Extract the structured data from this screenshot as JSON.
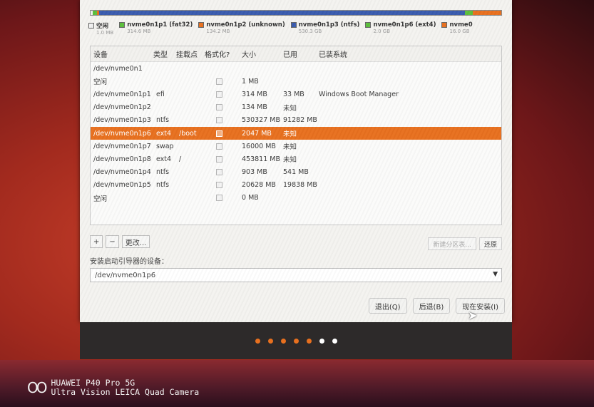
{
  "partition_bar": [
    {
      "color": "#f0f0f0",
      "pct": 0.6
    },
    {
      "color": "#5cbf3c",
      "pct": 1
    },
    {
      "color": "#e8701f",
      "pct": 0.5
    },
    {
      "color": "#3a5cae",
      "pct": 89
    },
    {
      "color": "#5cbf3c",
      "pct": 2
    },
    {
      "color": "#e8701f",
      "pct": 6.9
    }
  ],
  "legend": [
    {
      "name": "空闲",
      "size": "1.0 MB",
      "color": "#f0f0f0"
    },
    {
      "name": "nvme0n1p1 (fat32)",
      "size": "314.6 MB",
      "color": "#5cbf3c"
    },
    {
      "name": "nvme0n1p2 (unknown)",
      "size": "134.2 MB",
      "color": "#e8701f"
    },
    {
      "name": "nvme0n1p3 (ntfs)",
      "size": "530.3 GB",
      "color": "#3a5cae"
    },
    {
      "name": "nvme0n1p6 (ext4)",
      "size": "2.0 GB",
      "color": "#5cbf3c"
    },
    {
      "name": "nvme0",
      "size": "16.0 GB",
      "color": "#e8701f"
    }
  ],
  "table": {
    "headers": {
      "device": "设备",
      "type": "类型",
      "mount": "挂载点",
      "format": "格式化?",
      "size": "大小",
      "used": "已用",
      "os": "已装系统"
    },
    "rows": [
      {
        "device": "/dev/nvme0n1",
        "type": "",
        "mount": "",
        "check": false,
        "size": "",
        "used": "",
        "os": ""
      },
      {
        "device": "空闲",
        "type": "",
        "mount": "",
        "check": true,
        "size": "1 MB",
        "used": "",
        "os": ""
      },
      {
        "device": "/dev/nvme0n1p1",
        "type": "efi",
        "mount": "",
        "check": true,
        "size": "314 MB",
        "used": "33 MB",
        "os": "Windows Boot Manager"
      },
      {
        "device": "/dev/nvme0n1p2",
        "type": "",
        "mount": "",
        "check": true,
        "size": "134 MB",
        "used": "未知",
        "os": ""
      },
      {
        "device": "/dev/nvme0n1p3",
        "type": "ntfs",
        "mount": "",
        "check": true,
        "size": "530327 MB",
        "used": "91282 MB",
        "os": ""
      },
      {
        "device": "/dev/nvme0n1p6",
        "type": "ext4",
        "mount": "/boot",
        "check": true,
        "size": "2047 MB",
        "used": "未知",
        "os": "",
        "selected": true
      },
      {
        "device": "/dev/nvme0n1p7",
        "type": "swap",
        "mount": "",
        "check": true,
        "size": "16000 MB",
        "used": "未知",
        "os": ""
      },
      {
        "device": "/dev/nvme0n1p8",
        "type": "ext4",
        "mount": "/",
        "check": true,
        "size": "453811 MB",
        "used": "未知",
        "os": ""
      },
      {
        "device": "/dev/nvme0n1p4",
        "type": "ntfs",
        "mount": "",
        "check": true,
        "size": "903 MB",
        "used": "541 MB",
        "os": ""
      },
      {
        "device": "/dev/nvme0n1p5",
        "type": "ntfs",
        "mount": "",
        "check": true,
        "size": "20628 MB",
        "used": "19838 MB",
        "os": ""
      },
      {
        "device": "空闲",
        "type": "",
        "mount": "",
        "check": true,
        "size": "0 MB",
        "used": "",
        "os": ""
      }
    ]
  },
  "table_buttons": {
    "add": "+",
    "remove": "−",
    "change": "更改..."
  },
  "right_buttons": {
    "new_table": "新建分区表...",
    "revert": "还原"
  },
  "bootloader": {
    "label": "安装启动引导器的设备：",
    "value": "/dev/nvme0n1p6"
  },
  "actions": {
    "quit": "退出(Q)",
    "back": "后退(B)",
    "install": "现在安装(I)"
  },
  "progress_dots": [
    "#e8701f",
    "#e8701f",
    "#e8701f",
    "#e8701f",
    "#e8701f",
    "#ffffff",
    "#ffffff"
  ],
  "watermark": {
    "line1": "HUAWEI P40 Pro 5G",
    "line2": "Ultra Vision LEICA Quad Camera",
    "logo": "OO"
  }
}
